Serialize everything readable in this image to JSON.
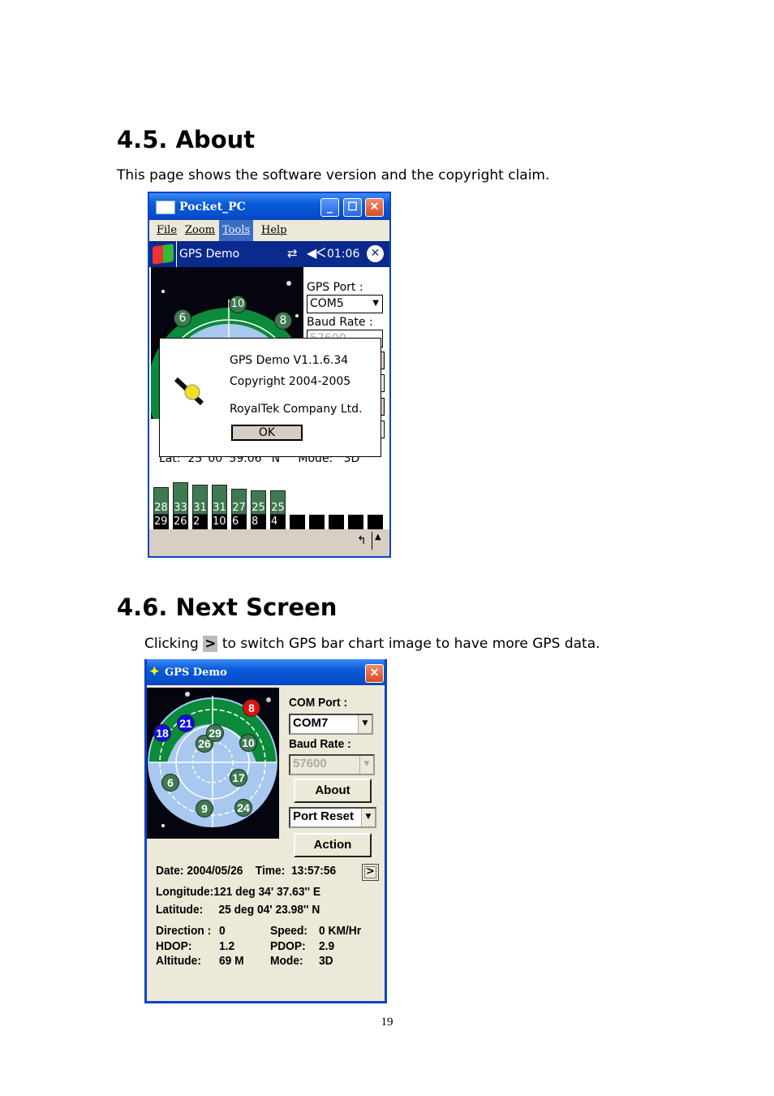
{
  "section1": {
    "heading": "4.5. About",
    "text": "This page shows the software version and the copyright claim."
  },
  "screen1": {
    "window_title": "Pocket_PC",
    "menu": [
      "File",
      "Zoom",
      "Tools",
      "Help"
    ],
    "active_menu": "Tools",
    "taskbar": {
      "app": "GPS Demo",
      "time": "01:06",
      "icons": [
        "windows-start-icon",
        "connectivity-icon",
        "speaker-muted-icon",
        "close-circle-icon"
      ]
    },
    "gps_port_label": "GPS Port :",
    "gps_port_value": "COM5",
    "baud_rate_label": "Baud Rate :",
    "baud_rate_value": "57600",
    "satellites": [
      "6",
      "10",
      "8"
    ],
    "status_line": {
      "lat_label": "Lat:",
      "lat_value": "25°00' 59.06'' N",
      "mode_label": "Mode:",
      "mode_value": "3D"
    },
    "about_dialog": {
      "version": "GPS Demo V1.1.6.34",
      "copyright": "Copyright 2004-2005",
      "company": "RoyalTek Company Ltd.",
      "ok": "OK"
    },
    "signal_bars": [
      {
        "snr": "28",
        "prn": "29",
        "level": 28
      },
      {
        "snr": "33",
        "prn": "26",
        "level": 33
      },
      {
        "snr": "31",
        "prn": "2",
        "level": 31
      },
      {
        "snr": "31",
        "prn": "10",
        "level": 31
      },
      {
        "snr": "27",
        "prn": "6",
        "level": 27
      },
      {
        "snr": "25",
        "prn": "8",
        "level": 25
      },
      {
        "snr": "25",
        "prn": "4",
        "level": 25
      }
    ],
    "empty_channels": 5,
    "colors": {
      "bar": "#3e7a50",
      "titlebar": "#0a5ad8",
      "taskbar": "#0b2a8e"
    }
  },
  "section2": {
    "heading": "4.6. Next Screen",
    "text_before": "Clicking",
    "key": ">",
    "text_after": "to switch GPS bar chart image to have more GPS data."
  },
  "screen2": {
    "window_title": "GPS Demo",
    "com_port_label": "COM Port :",
    "com_port_value": "COM7",
    "baud_rate_label": "Baud Rate :",
    "baud_rate_value": "57600",
    "about_button": "About",
    "port_reset_value": "Port Reset",
    "action_button": "Action",
    "satellites": [
      {
        "id": "8",
        "color": "#e01010"
      },
      {
        "id": "21",
        "color": "#1010e0"
      },
      {
        "id": "18",
        "color": "#1010e0"
      },
      {
        "id": "26",
        "color": "#3e7a50"
      },
      {
        "id": "29",
        "color": "#3e7a50"
      },
      {
        "id": "10",
        "color": "#3e7a50"
      },
      {
        "id": "6",
        "color": "#3e7a50"
      },
      {
        "id": "17",
        "color": "#3e7a50"
      },
      {
        "id": "9",
        "color": "#3e7a50"
      },
      {
        "id": "24",
        "color": "#3e7a50"
      }
    ],
    "date_label": "Date:",
    "date": "2004/05/26",
    "time_label": "Time:",
    "time": "13:57:56",
    "next_button": ">",
    "longitude_label": "Longitude:",
    "longitude": "121 deg 34' 37.63'' E",
    "latitude_label": "Latitude:",
    "latitude": "25  deg 04' 23.98'' N",
    "direction_label": "Direction :",
    "direction": "0",
    "speed_label": "Speed:",
    "speed": "0 KM/Hr",
    "hdop_label": "HDOP:",
    "hdop": "1.2",
    "pdop_label": "PDOP:",
    "pdop": "2.9",
    "altitude_label": "Altitude:",
    "altitude": "69 M",
    "mode_label": "Mode:",
    "mode": "3D"
  },
  "page_number": "19"
}
